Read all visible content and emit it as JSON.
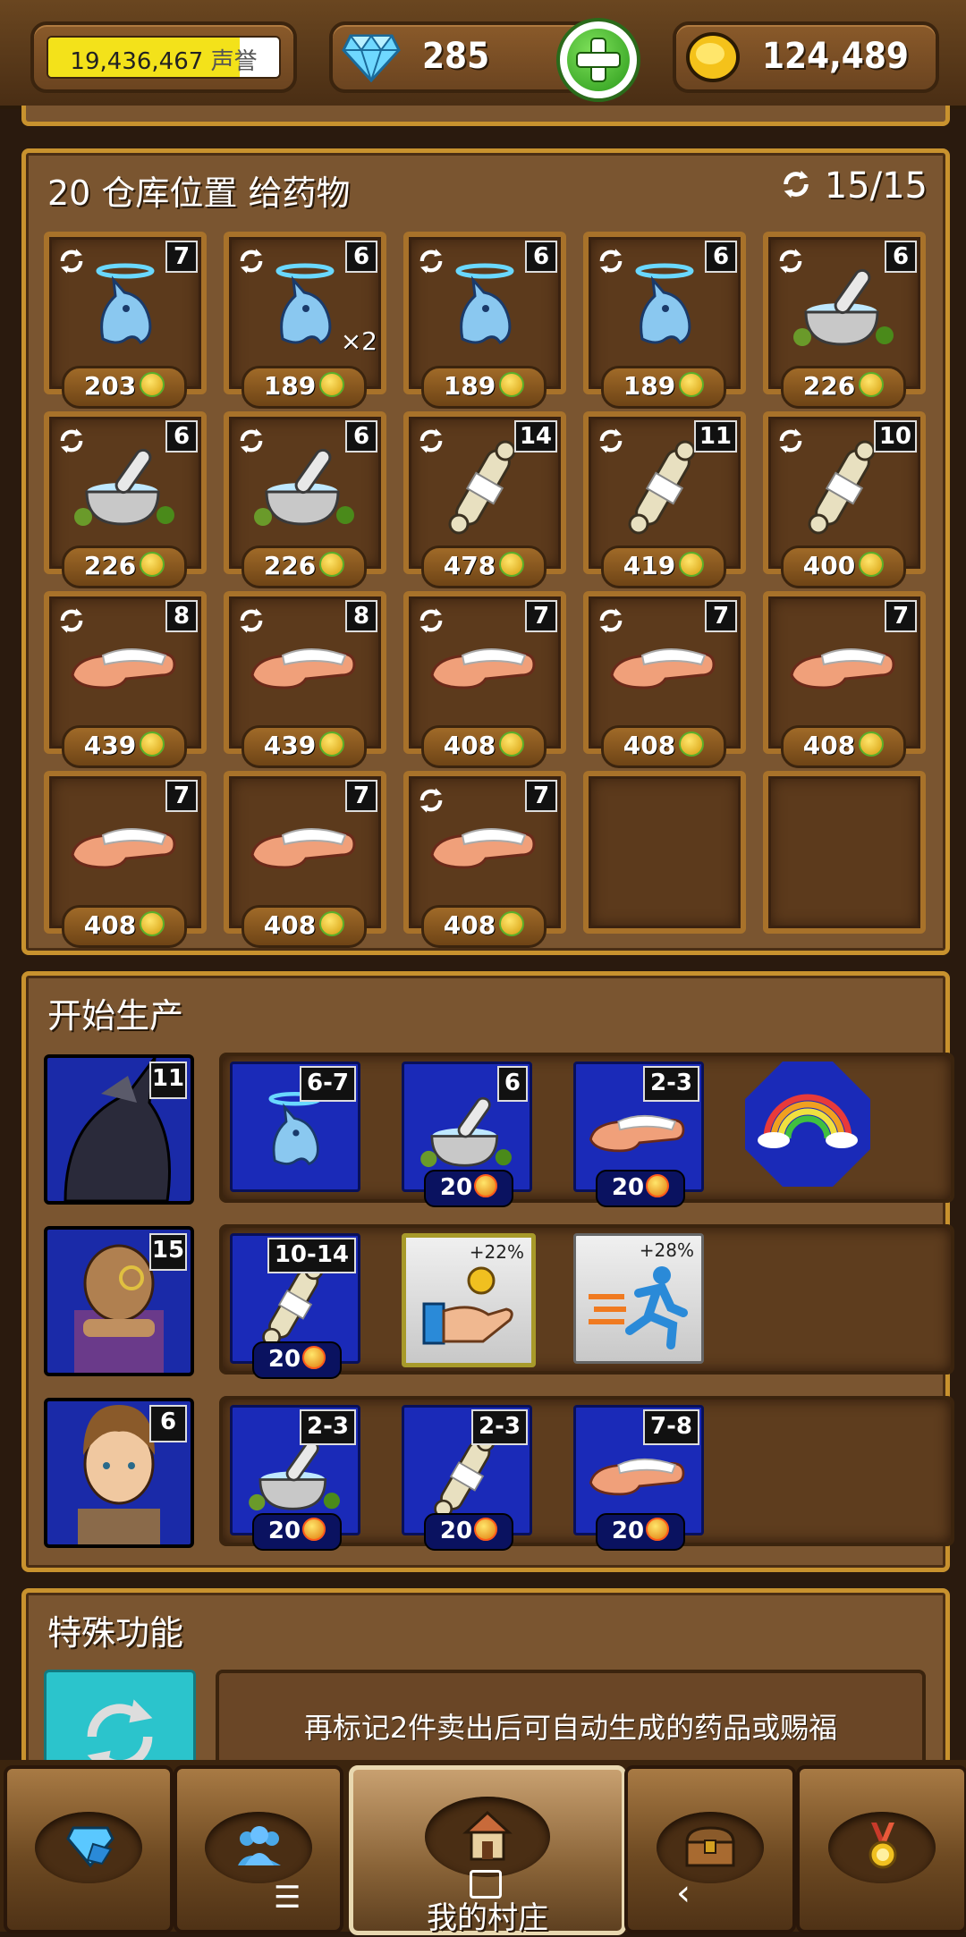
{
  "topbar": {
    "reputation_value": "19,436,467",
    "reputation_unit": "声誉",
    "reputation_fill": 0.83,
    "gems_value": "285",
    "coins_value": "124,489"
  },
  "storage": {
    "title": "20 仓库位置 给药物",
    "capacity": "15/15",
    "slots": [
      {
        "item": "unicorn-potion",
        "count": "7",
        "price": "203",
        "cycle": true,
        "extra": ""
      },
      {
        "item": "unicorn-potion",
        "count": "6",
        "price": "189",
        "cycle": true,
        "extra": "×2"
      },
      {
        "item": "unicorn-potion",
        "count": "6",
        "price": "189",
        "cycle": true,
        "extra": ""
      },
      {
        "item": "unicorn-potion",
        "count": "6",
        "price": "189",
        "cycle": true,
        "extra": ""
      },
      {
        "item": "mortar-potion",
        "count": "6",
        "price": "226",
        "cycle": true,
        "extra": ""
      },
      {
        "item": "mortar-potion",
        "count": "6",
        "price": "226",
        "cycle": true,
        "extra": ""
      },
      {
        "item": "mortar-potion",
        "count": "6",
        "price": "226",
        "cycle": true,
        "extra": ""
      },
      {
        "item": "bone-bandage",
        "count": "14",
        "price": "478",
        "cycle": true,
        "extra": ""
      },
      {
        "item": "bone-bandage",
        "count": "11",
        "price": "419",
        "cycle": true,
        "extra": ""
      },
      {
        "item": "bone-bandage",
        "count": "10",
        "price": "400",
        "cycle": true,
        "extra": ""
      },
      {
        "item": "arm-bandage",
        "count": "8",
        "price": "439",
        "cycle": true,
        "extra": ""
      },
      {
        "item": "arm-bandage",
        "count": "8",
        "price": "439",
        "cycle": true,
        "extra": ""
      },
      {
        "item": "arm-bandage",
        "count": "7",
        "price": "408",
        "cycle": true,
        "extra": ""
      },
      {
        "item": "arm-bandage",
        "count": "7",
        "price": "408",
        "cycle": true,
        "extra": ""
      },
      {
        "item": "arm-bandage",
        "count": "7",
        "price": "408",
        "cycle": false,
        "extra": ""
      },
      {
        "item": "arm-bandage",
        "count": "7",
        "price": "408",
        "cycle": false,
        "extra": ""
      },
      {
        "item": "arm-bandage",
        "count": "7",
        "price": "408",
        "cycle": false,
        "extra": ""
      },
      {
        "item": "arm-bandage",
        "count": "7",
        "price": "408",
        "cycle": true,
        "extra": ""
      },
      {
        "item": "empty",
        "count": "",
        "price": "",
        "cycle": false,
        "extra": ""
      },
      {
        "item": "empty",
        "count": "",
        "price": "",
        "cycle": false,
        "extra": ""
      }
    ]
  },
  "production": {
    "title": "开始生产",
    "rows": [
      {
        "worker": "dark-unicorn",
        "level": "11",
        "cards": [
          {
            "item": "unicorn-potion",
            "range": "6-7",
            "cost": ""
          },
          {
            "item": "mortar-potion",
            "range": "6",
            "cost": "20"
          },
          {
            "item": "arm-bandage",
            "range": "2-3",
            "cost": "20"
          }
        ]
      },
      {
        "worker": "monocle-man",
        "level": "15",
        "cards": [
          {
            "item": "bone-bandage",
            "range": "10-14",
            "cost": "20"
          }
        ],
        "bonuses": [
          {
            "icon": "coin-hand-icon",
            "value": "+22%"
          },
          {
            "icon": "running-man-icon",
            "value": "+28%"
          }
        ]
      },
      {
        "worker": "girl",
        "level": "6",
        "cards": [
          {
            "item": "mortar-potion",
            "range": "2-3",
            "cost": "20"
          },
          {
            "item": "bone-bandage",
            "range": "2-3",
            "cost": "20"
          },
          {
            "item": "arm-bandage",
            "range": "7-8",
            "cost": "20"
          }
        ]
      }
    ]
  },
  "special": {
    "title": "特殊功能",
    "description": "再标记2件卖出后可自动生成的药品或赐福"
  },
  "nav": {
    "home_label": "我的村庄",
    "icons": [
      "gem-icon",
      "people-icon",
      "house-icon",
      "chest-icon",
      "medal-icon"
    ]
  },
  "colors": {
    "accent": "#c8922e",
    "panel": "#7a5530",
    "card_blue": "#1a2ab8"
  }
}
